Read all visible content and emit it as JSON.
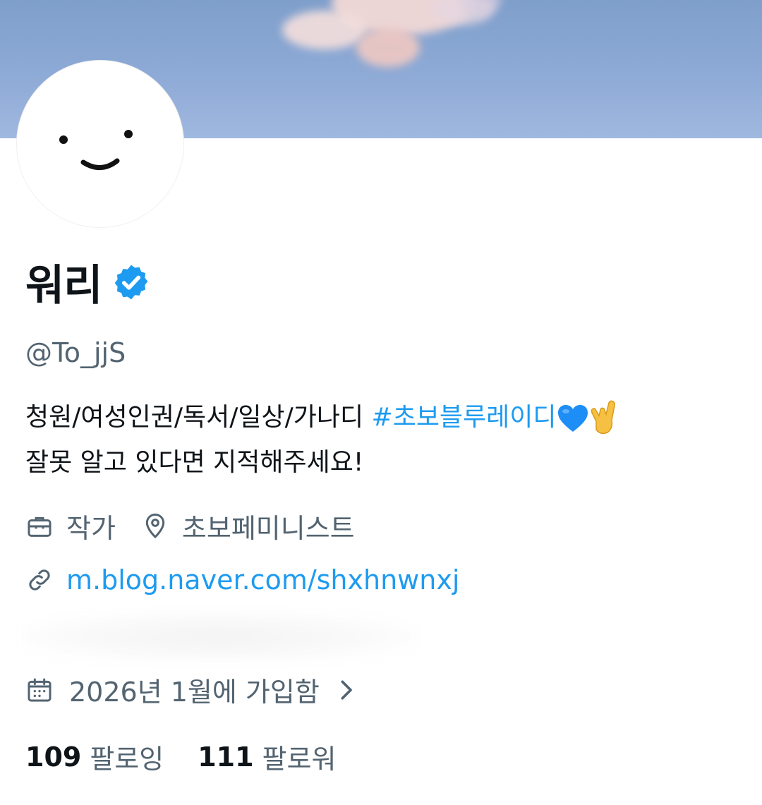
{
  "profile": {
    "display_name": "워리",
    "handle": "@To_jjS",
    "bio_line1_text": "청원/여성인권/독서/일상/가나디 ",
    "bio_hashtag": "#초보블루레이디",
    "bio_line2": "잘못 알고 있다면 지적해주세요!",
    "profession": "작가",
    "location": "초보페미니스트",
    "website": "m.blog.naver.com/shxhnwnxj",
    "joined": "2026년 1월에 가입함",
    "following_count": "109",
    "following_label": "팔로잉",
    "followers_count": "111",
    "followers_label": "팔로워"
  },
  "icons": {
    "verified": "verified-badge-icon",
    "profession": "briefcase-icon",
    "location": "location-pin-icon",
    "website": "link-icon",
    "joined": "calendar-icon",
    "chevron": "chevron-right-icon",
    "emoji_heart": "blue-heart-emoji",
    "emoji_hand": "call-me-hand-emoji"
  },
  "colors": {
    "accent": "#1d9bf0",
    "secondary_text": "#536471",
    "primary_text": "#0f1419"
  }
}
